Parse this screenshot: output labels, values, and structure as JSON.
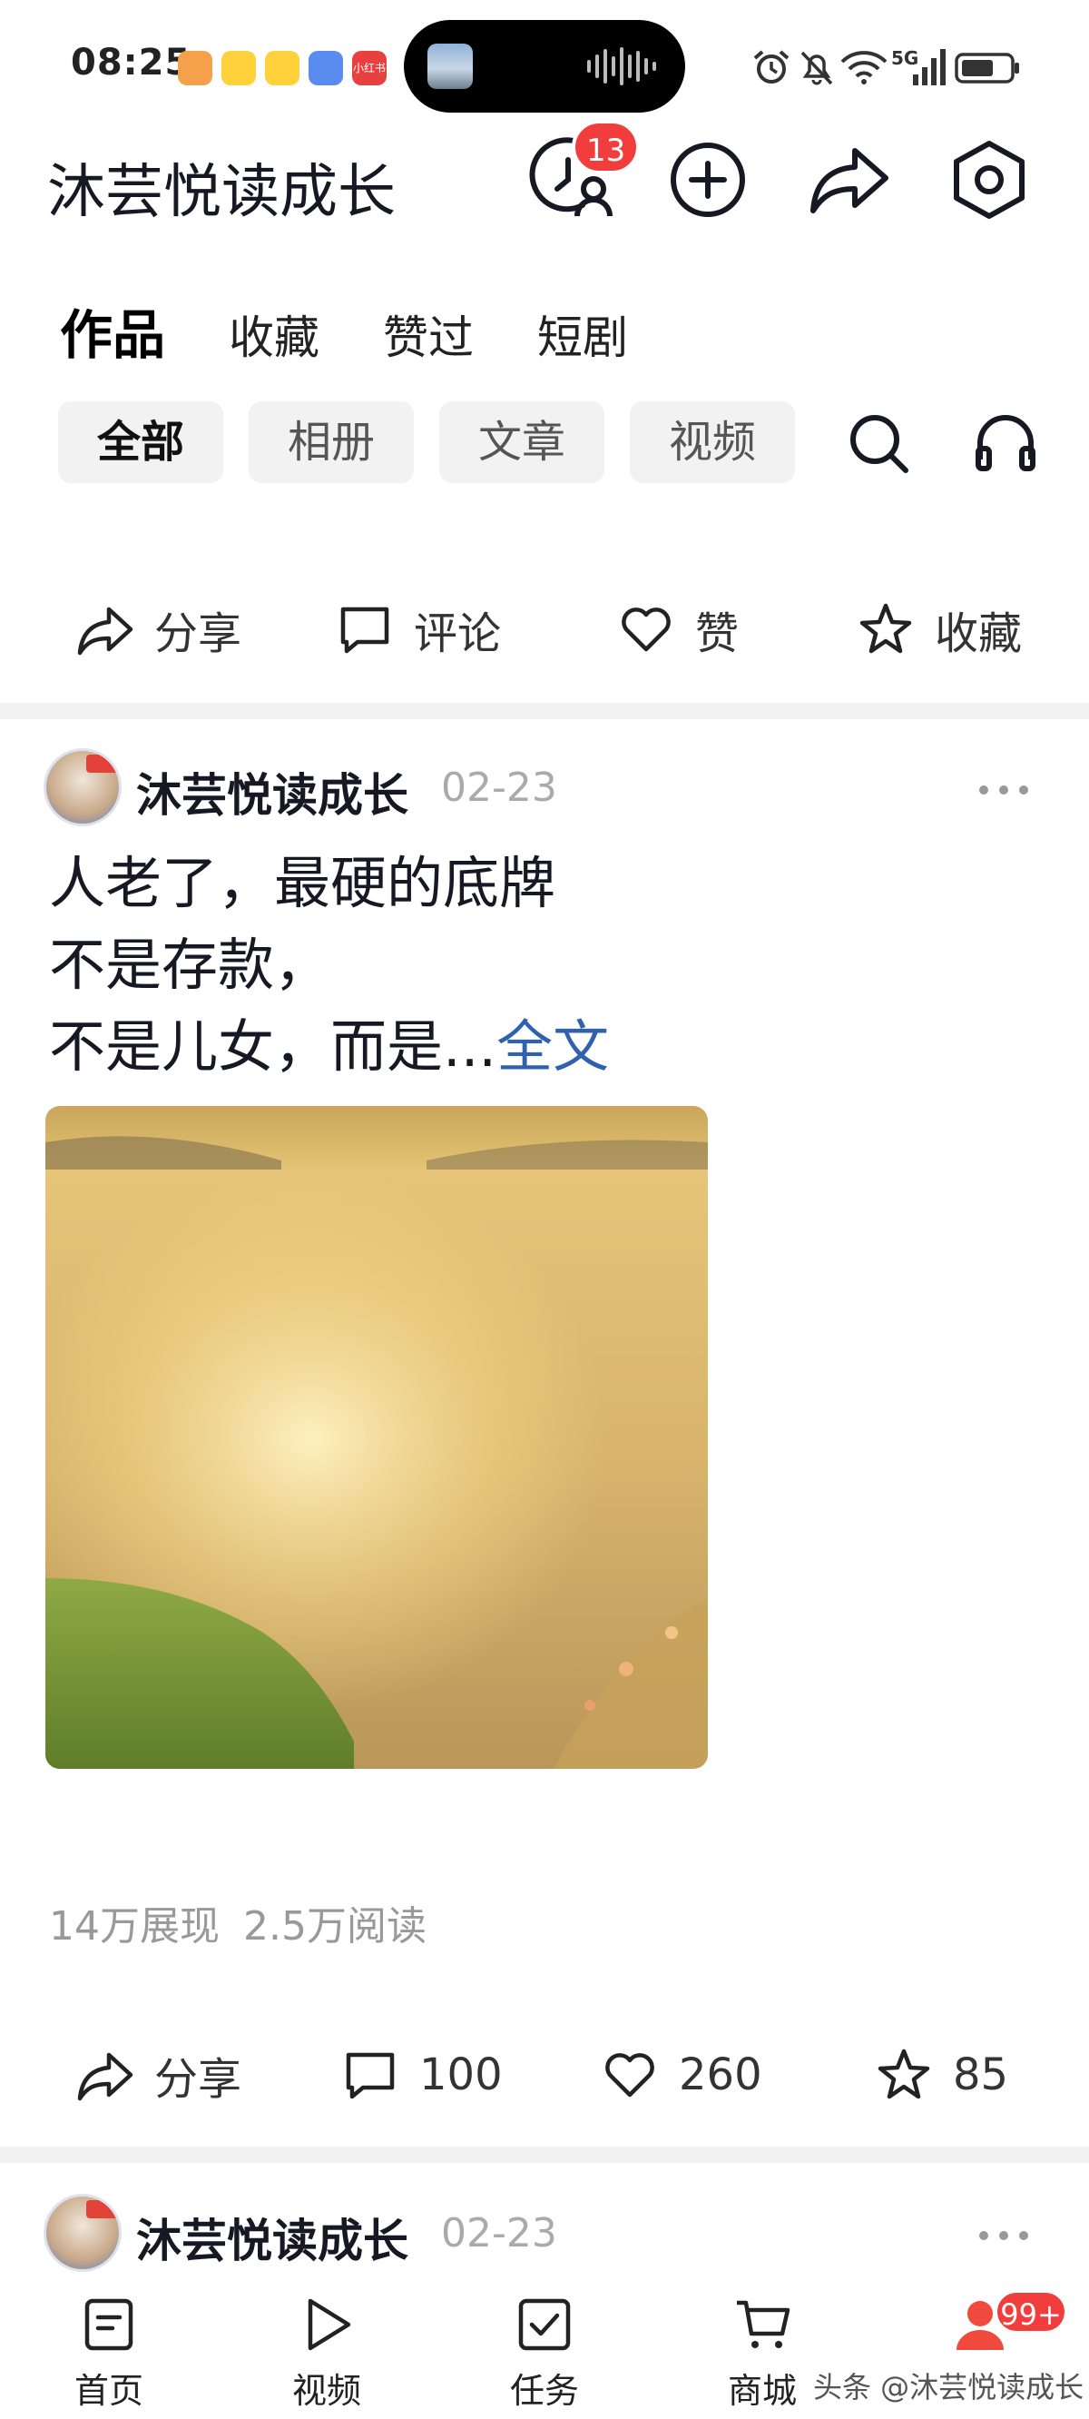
{
  "status_bar": {
    "time": "08:25",
    "network": "5G",
    "app_icon_colors": [
      "#f5a04a",
      "#ffd23c",
      "#ffd23c",
      "#5a8cf0",
      "#e84040"
    ],
    "app_icon_labels": [
      "",
      "",
      "",
      "",
      "小红书"
    ]
  },
  "header": {
    "title": "沐芸悦读成长",
    "visitor_badge": "13"
  },
  "tabs": {
    "items": [
      "作品",
      "收藏",
      "赞过",
      "短剧"
    ]
  },
  "filters": {
    "items": [
      "全部",
      "相册",
      "文章",
      "视频"
    ]
  },
  "top_actions": {
    "share": "分享",
    "comment": "评论",
    "like": "赞",
    "favorite": "收藏"
  },
  "post1": {
    "author": "沐芸悦读成长",
    "date": "02-23",
    "lines": [
      "人老了，最硬的底牌",
      "不是存款，",
      "不是儿女，而是..."
    ],
    "full_text_link": "全文",
    "impressions": "14万展现",
    "reads": "2.5万阅读",
    "share": "分享",
    "comments": "100",
    "likes": "260",
    "favorites": "85"
  },
  "post2": {
    "author": "沐芸悦读成长",
    "date": "02-23"
  },
  "bottom_nav": {
    "items": [
      "首页",
      "视频",
      "任务",
      "商城"
    ],
    "mine_badge": "99+",
    "watermark": "头条 @沐芸悦读成长"
  },
  "colors": {
    "accent_red": "#f23d3d",
    "link_blue": "#3060b0",
    "pill_bg": "#f2f2f3"
  }
}
